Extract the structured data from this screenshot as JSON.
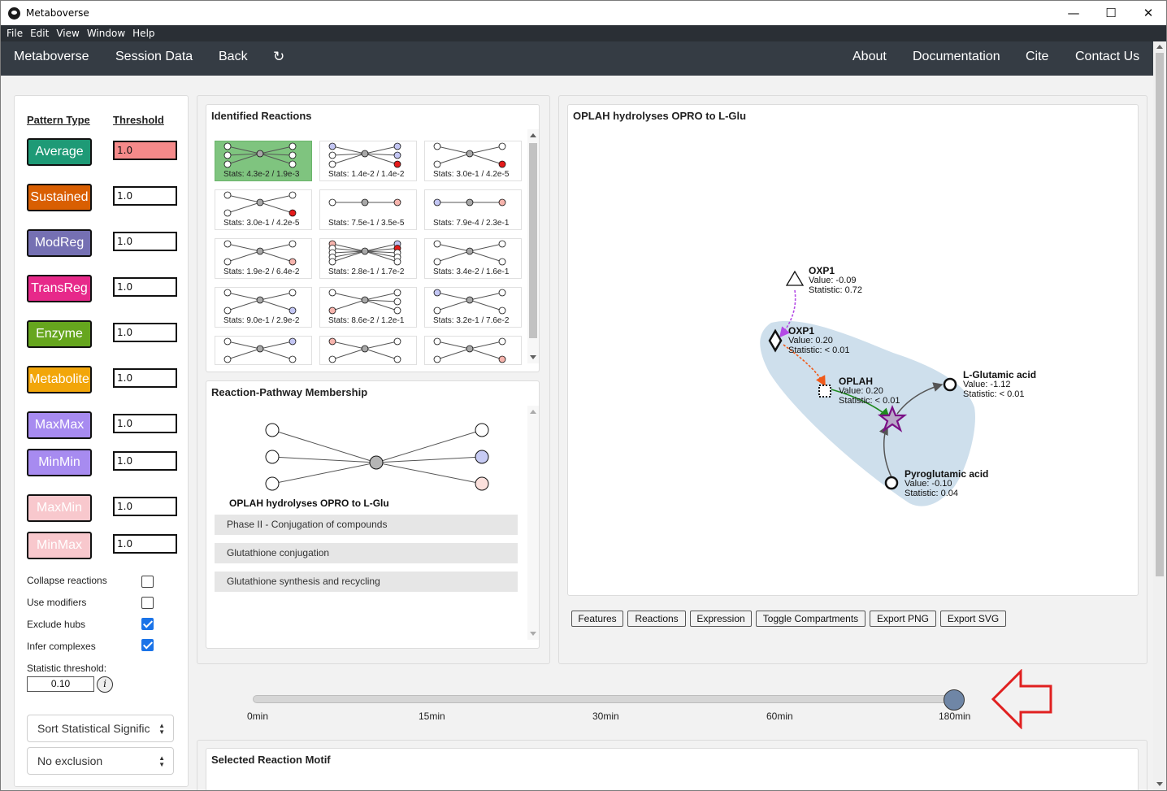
{
  "window": {
    "title": "Metaboverse",
    "minimize": "—",
    "maximize": "☐",
    "close": "✕"
  },
  "menu": [
    "File",
    "Edit",
    "View",
    "Window",
    "Help"
  ],
  "nav": {
    "left": [
      "Metaboverse",
      "Session Data",
      "Back"
    ],
    "refresh": "↻",
    "right": [
      "About",
      "Documentation",
      "Cite",
      "Contact Us"
    ]
  },
  "sidebar": {
    "pattern_header": "Pattern Type",
    "threshold_header": "Threshold",
    "patterns": [
      {
        "label": "Average",
        "color": "#1e9a76",
        "threshold": "1.0",
        "threshold_bg": "#f58a8a"
      },
      {
        "label": "Sustained",
        "color": "#d95f02",
        "threshold": "1.0",
        "threshold_bg": "#ffffff"
      },
      {
        "label": "ModReg",
        "color": "#7570b3",
        "threshold": "1.0",
        "threshold_bg": "#ffffff"
      },
      {
        "label": "TransReg",
        "color": "#e7298a",
        "threshold": "1.0",
        "threshold_bg": "#ffffff"
      },
      {
        "label": "Enzyme",
        "color": "#66a61e",
        "threshold": "1.0",
        "threshold_bg": "#ffffff"
      },
      {
        "label": "Metabolite",
        "color": "#f2a60a",
        "threshold": "1.0",
        "threshold_bg": "#ffffff"
      },
      {
        "label": "MaxMax",
        "color": "#a78bf0",
        "threshold": "1.0",
        "threshold_bg": "#ffffff"
      },
      {
        "label": "MinMin",
        "color": "#a78bf0",
        "threshold": "1.0",
        "threshold_bg": "#ffffff"
      },
      {
        "label": "MaxMin",
        "color": "#f8c8cd",
        "threshold": "1.0",
        "threshold_bg": "#ffffff"
      },
      {
        "label": "MinMax",
        "color": "#f8c8cd",
        "threshold": "1.0",
        "threshold_bg": "#ffffff"
      }
    ],
    "options": [
      {
        "label": "Collapse reactions",
        "checked": false
      },
      {
        "label": "Use modifiers",
        "checked": false
      },
      {
        "label": "Exclude hubs",
        "checked": true
      },
      {
        "label": "Infer complexes",
        "checked": true
      }
    ],
    "stat_label": "Statistic threshold:",
    "stat_value": "0.10",
    "info_icon": "i",
    "sort_select": "Sort Statistical Signific",
    "exclusion_select": "No exclusion"
  },
  "reactions": {
    "title": "Identified Reactions",
    "cells": [
      {
        "stats": "Stats: 4.3e-2 / 1.9e-3"
      },
      {
        "stats": "Stats: 1.4e-2 / 1.4e-2"
      },
      {
        "stats": "Stats: 3.0e-1 / 4.2e-5"
      },
      {
        "stats": "Stats: 3.0e-1 / 4.2e-5"
      },
      {
        "stats": "Stats: 7.5e-1 / 3.5e-5"
      },
      {
        "stats": "Stats: 7.9e-4 / 2.3e-1"
      },
      {
        "stats": "Stats: 1.9e-2 / 6.4e-2"
      },
      {
        "stats": "Stats: 2.8e-1 / 1.7e-2"
      },
      {
        "stats": "Stats: 3.4e-2 / 1.6e-1"
      },
      {
        "stats": "Stats: 9.0e-1 / 2.9e-2"
      },
      {
        "stats": "Stats: 8.6e-2 / 1.2e-1"
      },
      {
        "stats": "Stats: 3.2e-1 / 7.6e-2"
      },
      {
        "stats": ""
      },
      {
        "stats": ""
      },
      {
        "stats": ""
      }
    ]
  },
  "membership": {
    "title": "Reaction-Pathway Membership",
    "reaction_name": "OPLAH hydrolyses OPRO to L-Glu",
    "pathways": [
      "Phase II - Conjugation of compounds",
      "Glutathione conjugation",
      "Glutathione synthesis and recycling"
    ]
  },
  "network": {
    "title": "OPLAH hydrolyses OPRO to L-Glu",
    "nodes": [
      {
        "name": "OXP1",
        "value": "Value: -0.09",
        "statistic": "Statistic: 0.72"
      },
      {
        "name": "OXP1",
        "value": "Value: 0.20",
        "statistic": "Statistic: < 0.01"
      },
      {
        "name": "OPLAH",
        "value": "Value: 0.20",
        "statistic": "Statistic: < 0.01"
      },
      {
        "name": "L-Glutamic acid",
        "value": "Value: -1.12",
        "statistic": "Statistic: < 0.01"
      },
      {
        "name": "Pyroglutamic acid",
        "value": "Value: -0.10",
        "statistic": "Statistic: 0.04"
      }
    ],
    "buttons": [
      "Features",
      "Reactions",
      "Expression",
      "Toggle Compartments",
      "Export PNG",
      "Export SVG"
    ]
  },
  "timeline": {
    "labels": [
      "0min",
      "15min",
      "30min",
      "60min",
      "180min"
    ],
    "selected_index": 4
  },
  "motif": {
    "title": "Selected Reaction Motif"
  }
}
